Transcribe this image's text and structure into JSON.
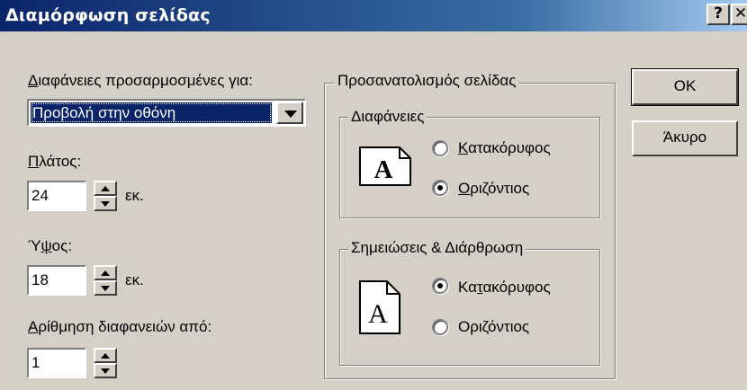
{
  "window": {
    "title": "Διαμόρφωση σελίδας",
    "help_label": "?",
    "close_label": "✕"
  },
  "left": {
    "sized_for_label_prefix": "Δ",
    "sized_for_label_rest": "ιαφάνειες προσαρμοσμένες για:",
    "sized_for_value": "Προβολή στην οθόνη",
    "width_label_prefix": "Π",
    "width_label_rest": "λάτος:",
    "width_value": "24",
    "width_unit": "εκ.",
    "height_label_prefix": "Ύ",
    "height_label_mid": "ψ",
    "height_label_rest": "ος:",
    "height_value": "18",
    "height_unit": "εκ.",
    "number_from_label_prefix": "Α",
    "number_from_label_rest": "ρίθμηση διαφανειών από:",
    "number_from_value": "1"
  },
  "orientation": {
    "title": "Προσανατολισμός σελίδας",
    "slides": {
      "title": "Διαφάνειες",
      "portrait_prefix": "Κ",
      "portrait_rest": "ατακόρυφος",
      "landscape_prefix": "Ο",
      "landscape_rest": "ριζόντιος",
      "selected": "landscape",
      "icon_letter": "A"
    },
    "notes": {
      "title": "Σημειώσεις & Διάρθρωση",
      "portrait_a": "Κα",
      "portrait_u": "τ",
      "portrait_rest": "ακόρυφος",
      "landscape": "Οριζόντιος",
      "selected": "portrait",
      "icon_letter": "A"
    }
  },
  "buttons": {
    "ok": "OK",
    "cancel": "Άκυρο"
  },
  "colors": {
    "title_bar_start": "#0a246a",
    "title_bar_end": "#a6caf0",
    "dialog_face": "#d4d0c8",
    "selection": "#0a246a"
  }
}
